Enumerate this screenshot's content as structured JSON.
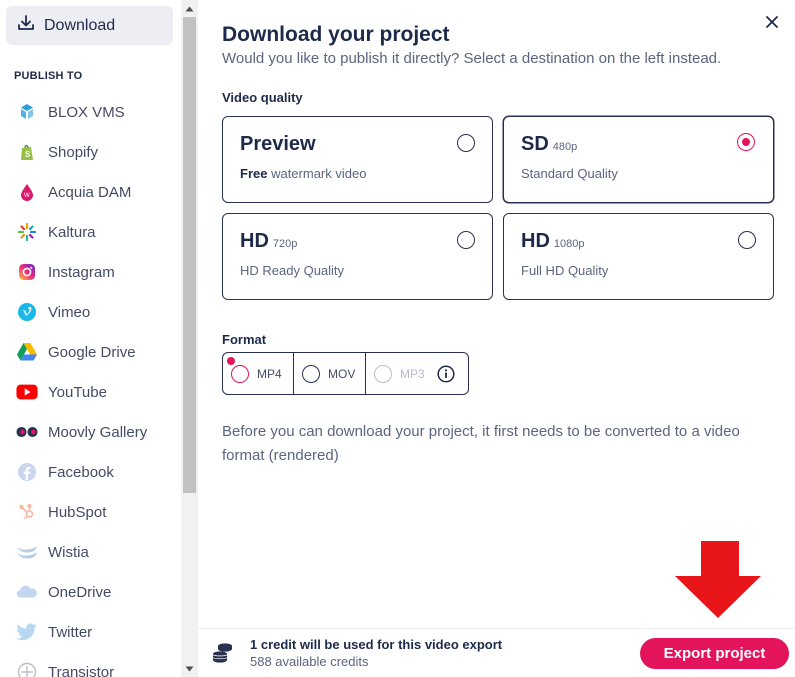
{
  "sidebar": {
    "download_label": "Download",
    "publish_heading": "PUBLISH TO",
    "destinations": [
      {
        "label": "BLOX VMS",
        "icon": "blox-icon"
      },
      {
        "label": "Shopify",
        "icon": "shopify-icon"
      },
      {
        "label": "Acquia DAM",
        "icon": "acquia-icon"
      },
      {
        "label": "Kaltura",
        "icon": "kaltura-icon"
      },
      {
        "label": "Instagram",
        "icon": "instagram-icon"
      },
      {
        "label": "Vimeo",
        "icon": "vimeo-icon"
      },
      {
        "label": "Google Drive",
        "icon": "google-drive-icon"
      },
      {
        "label": "YouTube",
        "icon": "youtube-icon"
      },
      {
        "label": "Moovly Gallery",
        "icon": "moovly-icon"
      },
      {
        "label": "Facebook",
        "icon": "facebook-icon"
      },
      {
        "label": "HubSpot",
        "icon": "hubspot-icon"
      },
      {
        "label": "Wistia",
        "icon": "wistia-icon"
      },
      {
        "label": "OneDrive",
        "icon": "onedrive-icon"
      },
      {
        "label": "Twitter",
        "icon": "twitter-icon"
      },
      {
        "label": "Transistor",
        "icon": "transistor-icon"
      }
    ]
  },
  "dialog": {
    "title": "Download your project",
    "subtitle": "Would you like to publish it directly? Select a destination on the left instead.",
    "quality_label": "Video quality",
    "qualities": [
      {
        "title": "Preview",
        "resolution": "",
        "desc_bold": "Free",
        "desc": " watermark video",
        "selected": false
      },
      {
        "title": "SD",
        "resolution": "480p",
        "desc_bold": "",
        "desc": "Standard Quality",
        "selected": true
      },
      {
        "title": "HD",
        "resolution": "720p",
        "desc_bold": "",
        "desc": "HD Ready Quality",
        "selected": false
      },
      {
        "title": "HD",
        "resolution": "1080p",
        "desc_bold": "",
        "desc": "Full HD Quality",
        "selected": false
      }
    ],
    "format_label": "Format",
    "formats": [
      {
        "label": "MP4",
        "selected": true,
        "disabled": false
      },
      {
        "label": "MOV",
        "selected": false,
        "disabled": false
      },
      {
        "label": "MP3",
        "selected": false,
        "disabled": true
      }
    ],
    "note": "Before you can download your project, it first needs to be converted to a video format (rendered)",
    "footer": {
      "credit_line": "1 credit will be used for this video export",
      "available_line": "588 available credits",
      "export_label": "Export project"
    }
  },
  "colors": {
    "accent": "#e3145c",
    "navy": "#1e2a4a",
    "arrow": "#e8151b"
  }
}
